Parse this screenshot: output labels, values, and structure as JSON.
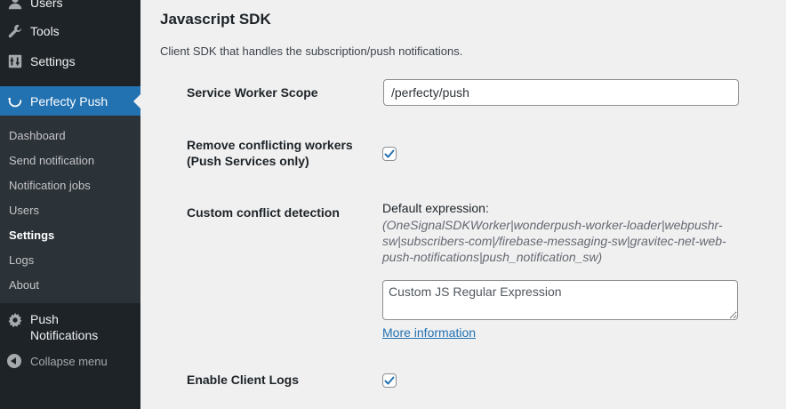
{
  "sidebar": {
    "top_items": [
      {
        "label": "Users",
        "icon": "users-icon"
      },
      {
        "label": "Tools",
        "icon": "wrench-icon"
      },
      {
        "label": "Settings",
        "icon": "settings-icon"
      }
    ],
    "active_item": {
      "label": "Perfecty Push",
      "icon": "smile-icon"
    },
    "submenu": [
      "Dashboard",
      "Send notification",
      "Notification jobs",
      "Users",
      "Settings",
      "Logs",
      "About"
    ],
    "submenu_current": "Settings",
    "bottom_item": {
      "label_line1": "Push",
      "label_line2": "Notifications",
      "icon": "gear-icon"
    },
    "collapse_label": "Collapse menu"
  },
  "section": {
    "title": "Javascript SDK",
    "description": "Client SDK that handles the subscription/push notifications."
  },
  "fields": {
    "service_worker_scope": {
      "label": "Service Worker Scope",
      "value": "/perfecty/push"
    },
    "remove_conflicting": {
      "label_line1": "Remove conflicting workers",
      "label_line2": "(Push Services only)",
      "checked": true
    },
    "custom_conflict": {
      "label": "Custom conflict detection",
      "default_label": "Default expression:",
      "default_expression": "(OneSignalSDKWorker|wonderpush-worker-loader|webpushr-sw|subscribers-com|/firebase-messaging-sw|gravitec-net-web-push-notifications|push_notification_sw)",
      "placeholder": "Custom JS Regular Expression",
      "more_info": "More information"
    },
    "enable_client_logs": {
      "label": "Enable Client Logs",
      "checked": true
    }
  },
  "colors": {
    "accent": "#2271b1",
    "sidebar_bg": "#1d2327",
    "submenu_bg": "#2c3338",
    "page_bg": "#f0f0f1"
  }
}
